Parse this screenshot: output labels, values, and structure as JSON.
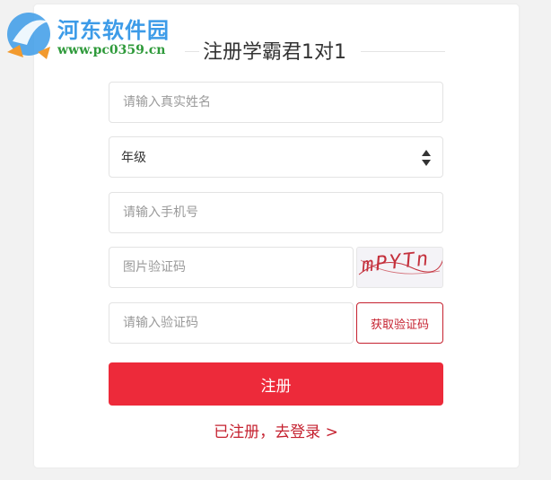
{
  "watermark": {
    "site_name": "河东软件园",
    "site_url": "www.pc0359.cn"
  },
  "form": {
    "title": "注册学霸君1对1",
    "name_placeholder": "请输入真实姓名",
    "grade_selected": "年级",
    "phone_placeholder": "请输入手机号",
    "image_code_placeholder": "图片验证码",
    "captcha_text": "mPYTn",
    "sms_code_placeholder": "请输入验证码",
    "get_code_label": "获取验证码",
    "register_label": "注册",
    "login_link": "已注册，去登录 >"
  },
  "colors": {
    "accent": "#ed2a3a",
    "accent_dark": "#c5212f",
    "watermark_blue": "#3c9be8",
    "watermark_green": "#2f9a3b"
  }
}
